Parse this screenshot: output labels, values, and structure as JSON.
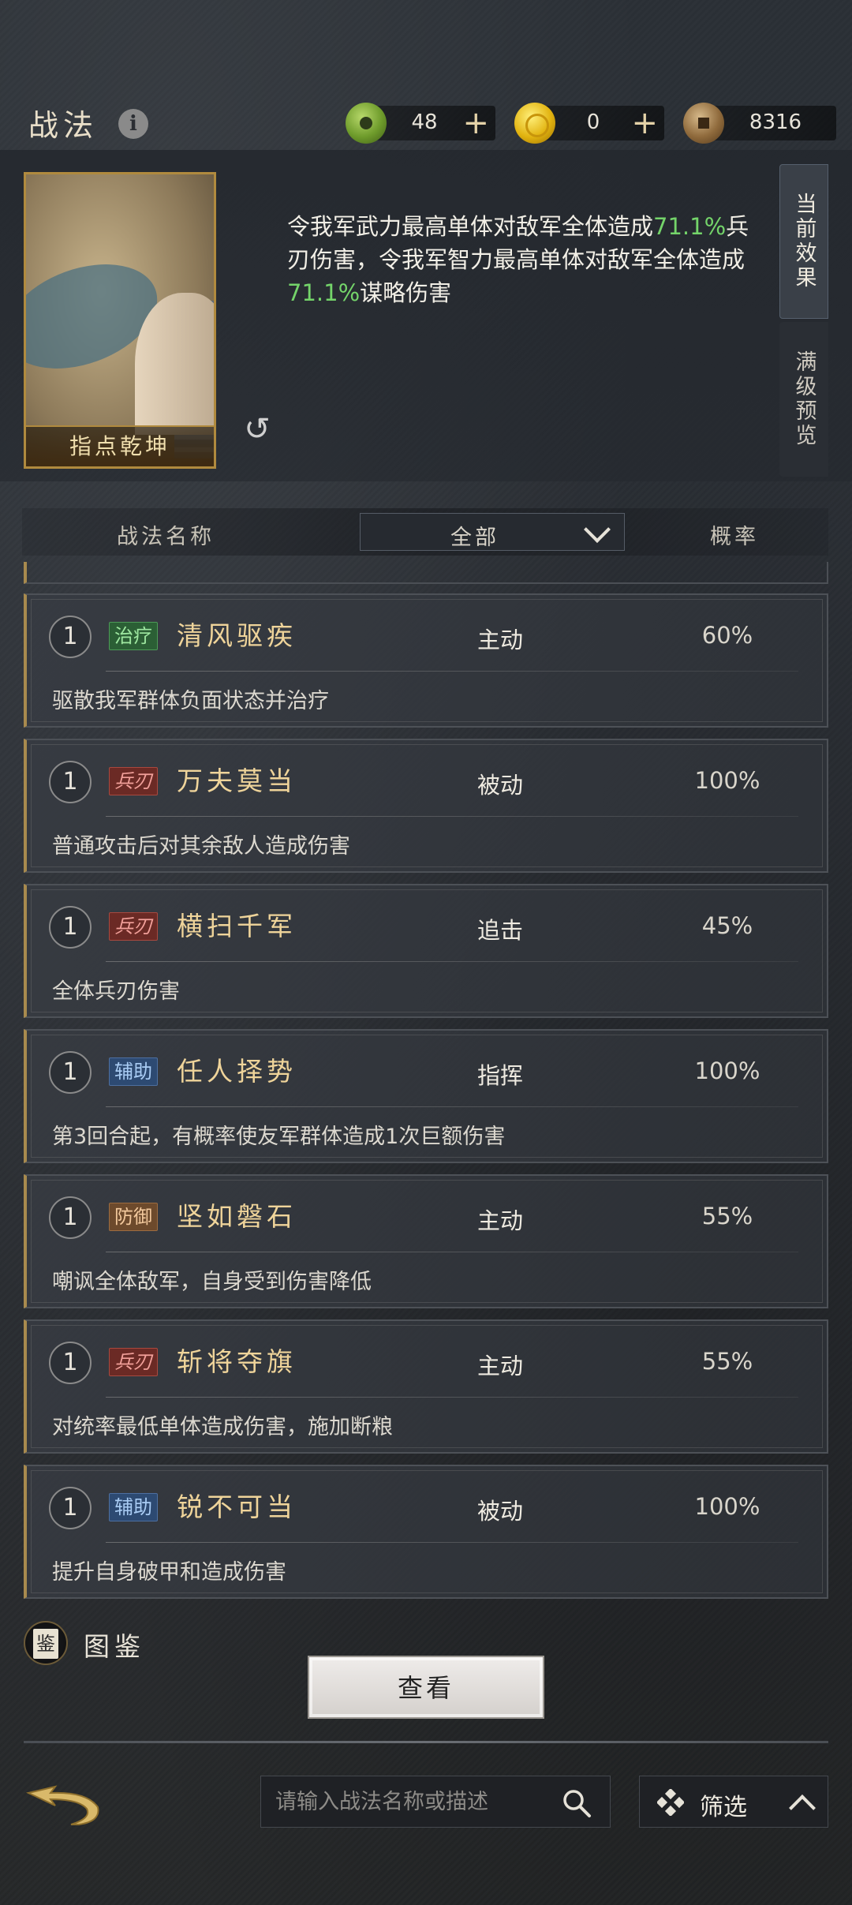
{
  "header": {
    "title": "战法",
    "currencies": [
      {
        "icon": "jade-coin-icon",
        "amount": "48",
        "plus": "+"
      },
      {
        "icon": "gold-coin-icon",
        "amount": "0",
        "plus": "+"
      },
      {
        "icon": "copper-coin-icon",
        "amount": "8316"
      }
    ]
  },
  "selected": {
    "card_name": "指点乾坤",
    "effect_parts": [
      "令我军武力最高单体对敌军全体造成",
      "71.1%",
      "兵刃伤害，令我军智力最高单体对敌军全体造成",
      "71.1%",
      "谋略伤害"
    ],
    "tabs": [
      "当前效果",
      "满级预览"
    ]
  },
  "filter": {
    "name_header": "战法名称",
    "category": "全部",
    "rate_header": "概率"
  },
  "skills": [
    {
      "level": "1",
      "tag": "治疗",
      "name": "清风驱疾",
      "type": "主动",
      "rate": "60%",
      "desc": "驱散我军群体负面状态并治疗"
    },
    {
      "level": "1",
      "tag": "兵刃",
      "name": "万夫莫当",
      "type": "被动",
      "rate": "100%",
      "desc": "普通攻击后对其余敌人造成伤害"
    },
    {
      "level": "1",
      "tag": "兵刃",
      "name": "横扫千军",
      "type": "追击",
      "rate": "45%",
      "desc": "全体兵刃伤害"
    },
    {
      "level": "1",
      "tag": "辅助",
      "name": "任人择势",
      "type": "指挥",
      "rate": "100%",
      "desc": "第3回合起，有概率使友军群体造成1次巨额伤害"
    },
    {
      "level": "1",
      "tag": "防御",
      "name": "坚如磐石",
      "type": "主动",
      "rate": "55%",
      "desc": "嘲讽全体敌军，自身受到伤害降低"
    },
    {
      "level": "1",
      "tag": "兵刃",
      "name": "斩将夺旗",
      "type": "主动",
      "rate": "55%",
      "desc": "对统率最低单体造成伤害，施加断粮"
    },
    {
      "level": "1",
      "tag": "辅助",
      "name": "锐不可当",
      "type": "被动",
      "rate": "100%",
      "desc": "提升自身破甲和造成伤害"
    }
  ],
  "footer": {
    "atlas_glyph": "鉴",
    "atlas_label": "图鉴",
    "view_button": "查看",
    "search_placeholder": "请输入战法名称或描述",
    "filter_label": "筛选"
  }
}
